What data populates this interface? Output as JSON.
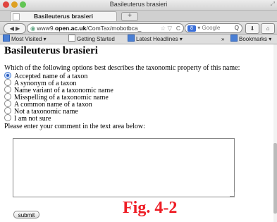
{
  "window": {
    "title": "Basileuterus brasieri"
  },
  "tabs": [
    {
      "label": "Basileuterus brasieri"
    }
  ],
  "newtab_label": "+",
  "nav": {
    "backfwd_label": "◀ ▶",
    "url_prefix": "www9.",
    "url_domain": "open.ac.uk",
    "url_path": "/ComTax/mobotbca_",
    "star_label": "☆ ▽",
    "reload_label": "C",
    "search_engine_badge": "8",
    "search_placeholder": "▾ Google",
    "search_icon_label": "Q",
    "download_label": "⬇",
    "home_label": "⌂"
  },
  "bookmarks": {
    "most_visited": "Most Visited ▾",
    "getting_started": "Getting Started",
    "latest_headlines": "Latest Headlines ▾",
    "overflow": "»",
    "bookmarks_menu": "Bookmarks ▾"
  },
  "page": {
    "heading": "Basileuterus brasieri",
    "question": "Which of the following options best describes the taxonomic property of this name:",
    "options": [
      {
        "label": "Accepted name of a taxon",
        "selected": true
      },
      {
        "label": "A synonym of a taxon",
        "selected": false
      },
      {
        "label": "Name variant of a taxonomic name",
        "selected": false
      },
      {
        "label": "Misspelling of a taxonomic name",
        "selected": false
      },
      {
        "label": "A common name of a taxon",
        "selected": false
      },
      {
        "label": "Not a taxonomic name",
        "selected": false
      },
      {
        "label": "I am not sure",
        "selected": false
      }
    ],
    "comment_prompt": "Please enter your comment in the text area below:",
    "comment_value": "",
    "submit_label": "submit"
  },
  "figure_label": "Fig. 4-2"
}
